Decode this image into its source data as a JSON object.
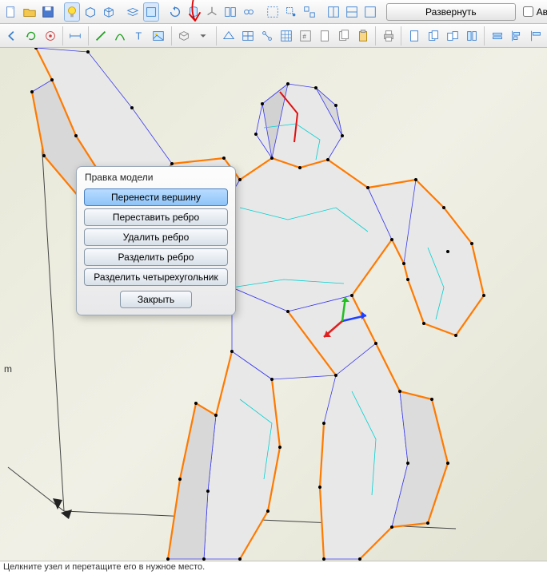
{
  "toolbar1": {
    "icons": [
      "new-icon",
      "open-icon",
      "save-icon",
      "lightbulb-icon",
      "cube-icon",
      "cube2-icon",
      "layer-icon",
      "shape-icon",
      "rotate-icon",
      "cylinder-icon",
      "axis-icon",
      "panel-icon",
      "link-icon",
      "select-icon",
      "marquee-icon",
      "group-icon",
      "split-h-icon",
      "split-v-icon",
      "window-icon"
    ],
    "unfold_label": "Развернуть",
    "auto_label": "Авто"
  },
  "toolbar2": {
    "icons": [
      "back-icon",
      "refresh-icon",
      "target-icon",
      "measure-icon",
      "edge-icon",
      "curve-icon",
      "text-icon",
      "picture-icon",
      "box-icon",
      "arrow-down-icon",
      "plane-icon",
      "map-icon",
      "flow-icon",
      "grid-icon",
      "num-icon",
      "doc-icon",
      "docs-icon",
      "clipboard-icon",
      "print-icon",
      "page-icon",
      "copy-page-icon",
      "pages-icon",
      "flip-h-icon",
      "flip-v-icon",
      "align-l-icon",
      "align-r-icon"
    ]
  },
  "popup": {
    "title": "Правка модели",
    "buttons": [
      "Перенести вершину",
      "Переставить ребро",
      "Удалить ребро",
      "Разделить ребро",
      "Разделить четырехугольник"
    ],
    "close": "Закрыть"
  },
  "viewport": {
    "side_label": "m"
  },
  "status": {
    "text": "Целкните узел и перетащите его в нужное место."
  },
  "annotation": {
    "arrow": "↓"
  },
  "colors": {
    "edge_sel": "#ff7a00",
    "edge_wire": "#3a3af0",
    "edge_cyan": "#00d0d0",
    "edge_red": "#e01010",
    "vertex": "#000000"
  }
}
